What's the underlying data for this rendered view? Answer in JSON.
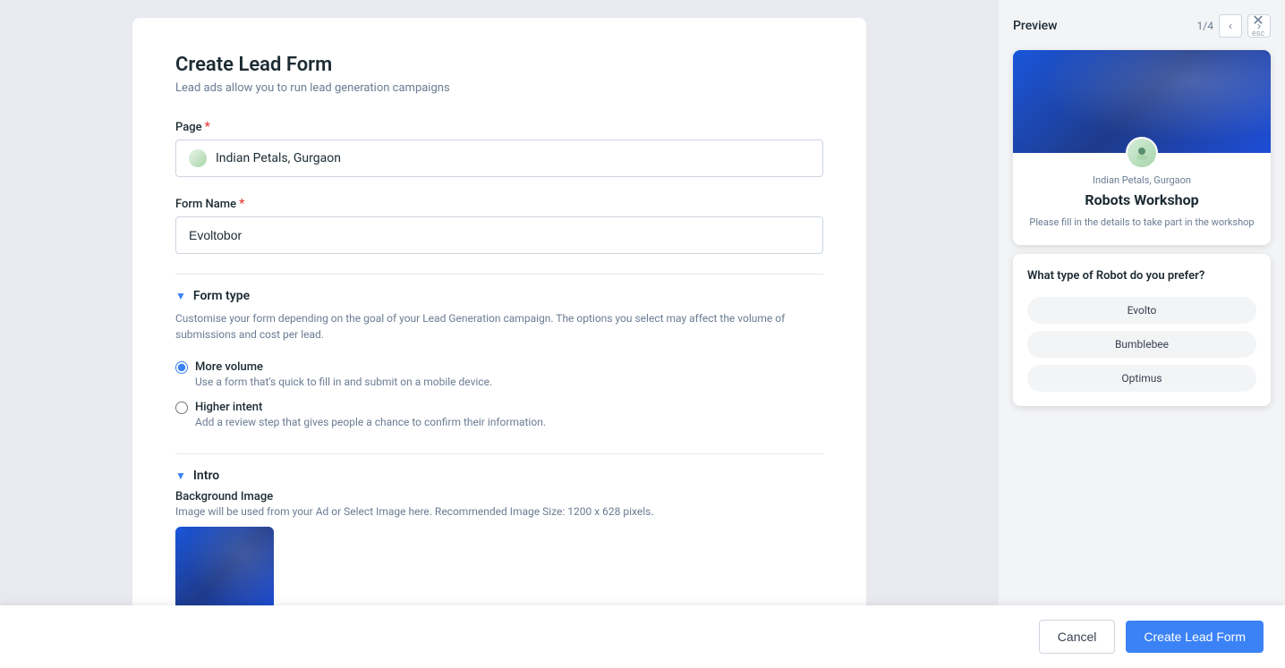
{
  "page": {
    "title": "Create Lead Form",
    "subtitle": "Lead ads allow you to run lead generation campaigns"
  },
  "fields": {
    "page_label": "Page",
    "page_value": "Indian Petals, Gurgaon",
    "form_name_label": "Form Name",
    "form_name_value": "Evoltobor"
  },
  "form_type_section": {
    "title": "Form type",
    "description": "Customise your form depending on the goal of your Lead Generation campaign. The options you select may affect the volume of submissions and cost per lead.",
    "options": [
      {
        "id": "more_volume",
        "label": "More volume",
        "description": "Use a form that's quick to fill in and submit on a mobile device.",
        "checked": true
      },
      {
        "id": "higher_intent",
        "label": "Higher intent",
        "description": "Add a review step that gives people a chance to confirm their information.",
        "checked": false
      }
    ]
  },
  "intro_section": {
    "title": "Intro",
    "bg_image_label": "Background Image",
    "bg_image_desc": "Image will be used from your Ad or Select Image here. Recommended Image Size: 1200 x 628 pixels."
  },
  "preview": {
    "title": "Preview",
    "pagination": "1/4",
    "page_name": "Indian Petals, Gurgaon",
    "form_title": "Robots Workshop",
    "form_desc": "Please fill in the details to take part in the workshop",
    "question_title": "What type of Robot do you prefer?",
    "options": [
      "Evolto",
      "Bumblebee",
      "Optimus"
    ],
    "prev_label": "‹",
    "next_label": "›",
    "close_label": "✕",
    "esc_label": "esc"
  },
  "footer": {
    "cancel_label": "Cancel",
    "create_label": "Create Lead Form"
  }
}
